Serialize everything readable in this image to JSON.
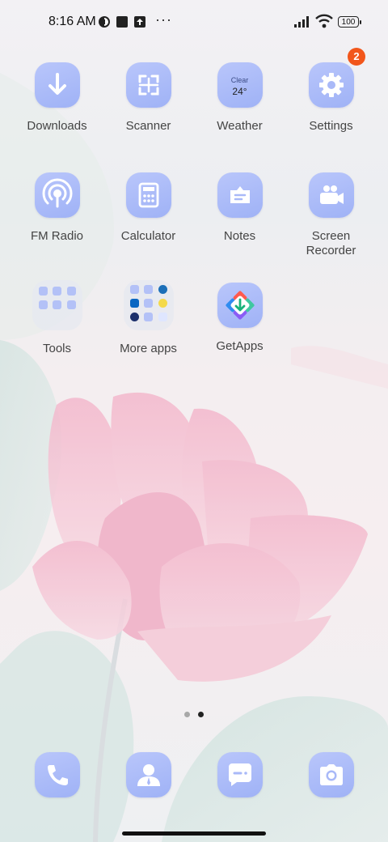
{
  "status_bar": {
    "time": "8:16 AM",
    "icons": [
      "private-dns-icon",
      "app-notification-icon",
      "upload-icon",
      "more-dots-icon",
      "signal-icon",
      "wifi-icon",
      "battery-icon"
    ],
    "more_dots": "···",
    "battery_level": "100"
  },
  "apps_row1": [
    {
      "label": "Downloads",
      "icon": "download-arrow-icon"
    },
    {
      "label": "Scanner",
      "icon": "scan-icon"
    },
    {
      "label": "Weather",
      "icon": "weather-icon",
      "condition": "Clear",
      "temperature": "24°"
    },
    {
      "label": "Settings",
      "icon": "gear-icon",
      "badge": "2"
    }
  ],
  "apps_row2": [
    {
      "label": "FM Radio",
      "icon": "radio-antenna-icon"
    },
    {
      "label": "Calculator",
      "icon": "calculator-icon"
    },
    {
      "label": "Notes",
      "icon": "notes-icon"
    },
    {
      "label": "Screen\nRecorder",
      "icon": "video-camera-icon"
    }
  ],
  "apps_row3": [
    {
      "label": "Tools",
      "icon": "folder-icon"
    },
    {
      "label": "More apps",
      "icon": "folder-icon"
    },
    {
      "label": "GetApps",
      "icon": "getapps-icon"
    }
  ],
  "dock": [
    {
      "icon": "phone-icon"
    },
    {
      "icon": "contacts-icon"
    },
    {
      "icon": "messages-icon"
    },
    {
      "icon": "camera-icon"
    }
  ],
  "page_indicator": {
    "count": 2,
    "active": 2
  },
  "colors": {
    "icon_bg": "#a9b9f8",
    "badge": "#f2561b",
    "label": "#444444"
  }
}
